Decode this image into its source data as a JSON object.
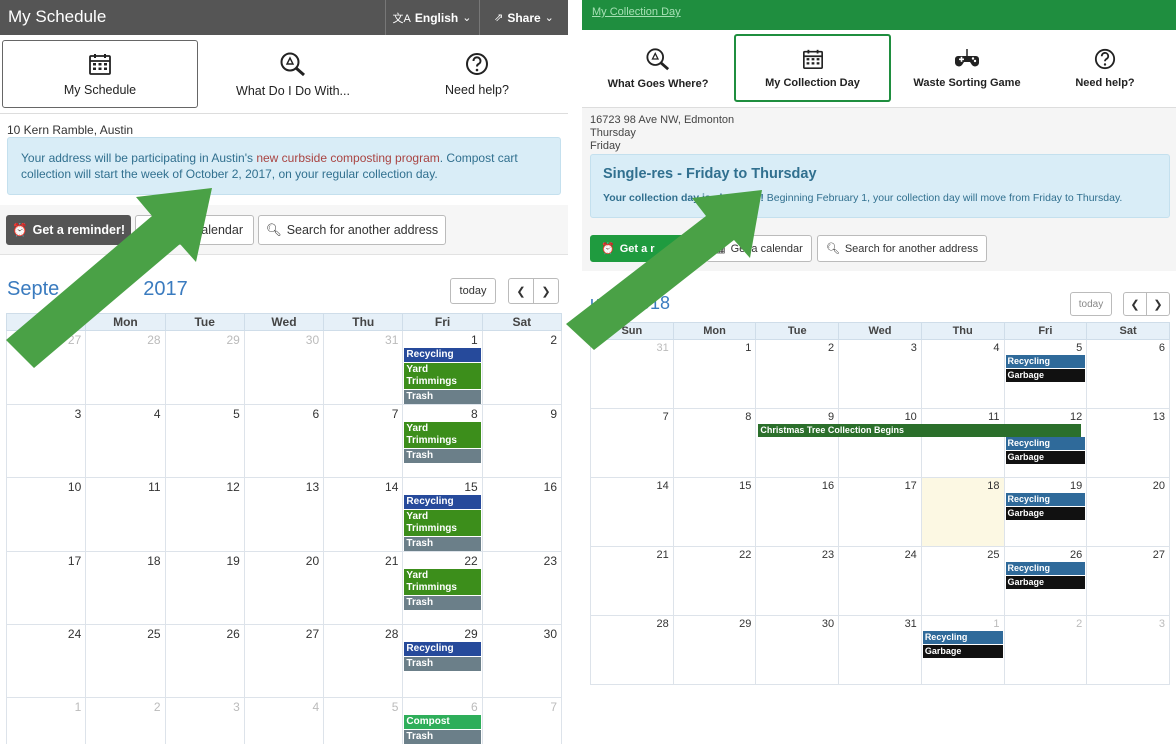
{
  "left": {
    "header": {
      "title": "My Schedule",
      "language": "English",
      "share": "Share"
    },
    "tabs": [
      {
        "label": "My Schedule",
        "icon": "calendar-icon",
        "active": true
      },
      {
        "label": "What Do I Do With...",
        "icon": "recycle-search-icon",
        "active": false
      },
      {
        "label": "Need help?",
        "icon": "help-icon",
        "active": false
      }
    ],
    "address": "10 Kern Ramble, Austin",
    "notice": {
      "before": "Your address will be participating in Austin's ",
      "link": "new curbside composting program",
      "after": ". Compost cart collection will start the week of October 2, 2017, on your regular collection day."
    },
    "buttons": {
      "reminder": "Get a reminder!",
      "calendar": "alendar",
      "search": "Search for another address"
    },
    "month": "Septe",
    "year": "2017",
    "today": "today",
    "weekdays": [
      "",
      "Mon",
      "Tue",
      "Wed",
      "Thu",
      "Fri",
      "Sat"
    ],
    "weeks": [
      [
        {
          "d": "27",
          "other": true
        },
        {
          "d": "28",
          "other": true
        },
        {
          "d": "29",
          "other": true
        },
        {
          "d": "30",
          "other": true
        },
        {
          "d": "31",
          "other": true
        },
        {
          "d": "1",
          "ev": [
            [
              "recycle-l",
              "Recycling"
            ],
            [
              "yard",
              "Yard Trimmings"
            ],
            [
              "trash-l",
              "Trash"
            ]
          ]
        },
        {
          "d": "2"
        }
      ],
      [
        {
          "d": "3"
        },
        {
          "d": "4"
        },
        {
          "d": "5"
        },
        {
          "d": "6"
        },
        {
          "d": "7"
        },
        {
          "d": "8",
          "ev": [
            [
              "yard",
              "Yard Trimmings"
            ],
            [
              "trash-l",
              "Trash"
            ]
          ]
        },
        {
          "d": "9"
        }
      ],
      [
        {
          "d": "10"
        },
        {
          "d": "11"
        },
        {
          "d": "12"
        },
        {
          "d": "13"
        },
        {
          "d": "14"
        },
        {
          "d": "15",
          "ev": [
            [
              "recycle-l",
              "Recycling"
            ],
            [
              "yard",
              "Yard Trimmings"
            ],
            [
              "trash-l",
              "Trash"
            ]
          ]
        },
        {
          "d": "16"
        }
      ],
      [
        {
          "d": "17"
        },
        {
          "d": "18"
        },
        {
          "d": "19"
        },
        {
          "d": "20"
        },
        {
          "d": "21"
        },
        {
          "d": "22",
          "ev": [
            [
              "yard",
              "Yard Trimmings"
            ],
            [
              "trash-l",
              "Trash"
            ]
          ]
        },
        {
          "d": "23"
        }
      ],
      [
        {
          "d": "24"
        },
        {
          "d": "25"
        },
        {
          "d": "26"
        },
        {
          "d": "27"
        },
        {
          "d": "28"
        },
        {
          "d": "29",
          "ev": [
            [
              "recycle-l",
              "Recycling"
            ],
            [
              "trash-l",
              "Trash"
            ]
          ]
        },
        {
          "d": "30"
        }
      ],
      [
        {
          "d": "1",
          "other": true
        },
        {
          "d": "2",
          "other": true
        },
        {
          "d": "3",
          "other": true
        },
        {
          "d": "4",
          "other": true
        },
        {
          "d": "5",
          "other": true
        },
        {
          "d": "6",
          "other": true,
          "ev": [
            [
              "compost",
              "Compost"
            ],
            [
              "trash-l",
              "Trash"
            ]
          ]
        },
        {
          "d": "7",
          "other": true
        }
      ]
    ]
  },
  "right": {
    "header": {
      "title": "My Collection Day"
    },
    "tabs": [
      {
        "label": "What Goes Where?",
        "icon": "recycle-search-icon",
        "active": false
      },
      {
        "label": "My Collection Day",
        "icon": "calendar-icon",
        "active": true
      },
      {
        "label": "Waste Sorting Game",
        "icon": "gamepad-icon",
        "active": false
      },
      {
        "label": "Need help?",
        "icon": "help-icon",
        "active": false
      }
    ],
    "address": [
      "16723 98 Ave NW, Edmonton",
      "Thursday",
      "Friday"
    ],
    "notice": {
      "title": "Single-res - Friday to Thursday",
      "bold": "Your collection day is changing!",
      "text": " Beginning February 1, your collection day will move from Friday to Thursday."
    },
    "buttons": {
      "reminder": "Get a r",
      "calendar": "Get a calendar",
      "search": "Search for another address"
    },
    "month": "uary 2018",
    "today": "today",
    "weekdays": [
      "Sun",
      "Mon",
      "Tue",
      "Wed",
      "Thu",
      "Fri",
      "Sat"
    ],
    "xmas": "Christmas Tree Collection Begins",
    "weeks": [
      [
        {
          "d": "31",
          "other": true
        },
        {
          "d": "1"
        },
        {
          "d": "2"
        },
        {
          "d": "3"
        },
        {
          "d": "4"
        },
        {
          "d": "5",
          "ev": [
            [
              "recycle-r",
              "Recycling"
            ],
            [
              "garbage",
              "Garbage"
            ]
          ]
        },
        {
          "d": "6"
        }
      ],
      [
        {
          "d": "7"
        },
        {
          "d": "8"
        },
        {
          "d": "9",
          "xmas": true
        },
        {
          "d": "10"
        },
        {
          "d": "11"
        },
        {
          "d": "12",
          "spaced": true,
          "ev": [
            [
              "recycle-r",
              "Recycling"
            ],
            [
              "garbage",
              "Garbage"
            ]
          ]
        },
        {
          "d": "13"
        }
      ],
      [
        {
          "d": "14"
        },
        {
          "d": "15"
        },
        {
          "d": "16"
        },
        {
          "d": "17"
        },
        {
          "d": "18",
          "today": true
        },
        {
          "d": "19",
          "ev": [
            [
              "recycle-r",
              "Recycling"
            ],
            [
              "garbage",
              "Garbage"
            ]
          ]
        },
        {
          "d": "20"
        }
      ],
      [
        {
          "d": "21"
        },
        {
          "d": "22"
        },
        {
          "d": "23"
        },
        {
          "d": "24"
        },
        {
          "d": "25"
        },
        {
          "d": "26",
          "ev": [
            [
              "recycle-r",
              "Recycling"
            ],
            [
              "garbage",
              "Garbage"
            ]
          ]
        },
        {
          "d": "27"
        }
      ],
      [
        {
          "d": "28"
        },
        {
          "d": "29"
        },
        {
          "d": "30"
        },
        {
          "d": "31"
        },
        {
          "d": "1",
          "other": true,
          "ev": [
            [
              "recycle-r",
              "Recycling"
            ],
            [
              "garbage",
              "Garbage"
            ]
          ]
        },
        {
          "d": "2",
          "other": true
        },
        {
          "d": "3",
          "other": true
        }
      ]
    ]
  },
  "colors": {
    "arrow": "#4aa146",
    "austin_header": "#555555",
    "edmonton_header": "#1f8e3f",
    "notice_bg": "#d9edf7"
  }
}
